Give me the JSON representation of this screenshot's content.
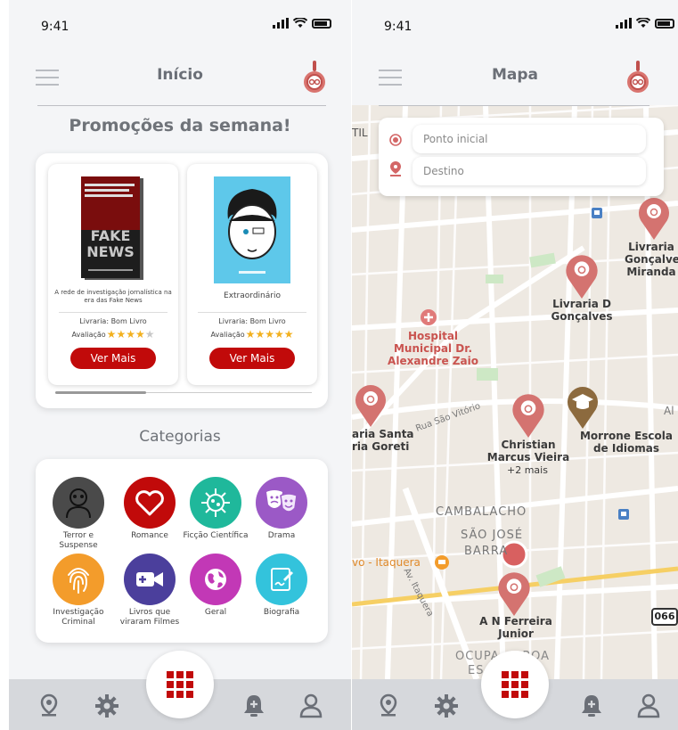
{
  "status": {
    "time": "9:41"
  },
  "home": {
    "title": "Início",
    "promo_title": "Promoções da semana!",
    "books": [
      {
        "title": "A rede de investigação jornalística na era das Fake News",
        "store_label": "Livraria:",
        "store": "Bom Livro",
        "rating_label": "Avaliação",
        "rating": 4,
        "button": "Ver Mais"
      },
      {
        "title": "Extraordinário",
        "store_label": "Livraria:",
        "store": "Bom Livro",
        "rating_label": "Avaliação",
        "rating": 5,
        "button": "Ver Mais"
      }
    ],
    "categories_title": "Categorias",
    "categories": [
      {
        "label": "Terror e Suspense",
        "color": "#4a4a4a",
        "icon": "zombie-icon"
      },
      {
        "label": "Romance",
        "color": "#c10a0a",
        "icon": "heart-icon"
      },
      {
        "label": "Ficção Científica",
        "color": "#1fb89b",
        "icon": "virus-icon"
      },
      {
        "label": "Drama",
        "color": "#9b59c6",
        "icon": "theater-masks-icon"
      },
      {
        "label": "Investigação Criminal",
        "color": "#f39c2b",
        "icon": "fingerprint-icon"
      },
      {
        "label": "Livros que viraram Filmes",
        "color": "#4b3f9c",
        "icon": "video-camera-icon"
      },
      {
        "label": "Geral",
        "color": "#c238b6",
        "icon": "globe-icon"
      },
      {
        "label": "Biografia",
        "color": "#33c3dc",
        "icon": "writing-icon"
      }
    ]
  },
  "map": {
    "title": "Mapa",
    "start_placeholder": "Ponto inicial",
    "dest_placeholder": "Destino",
    "labels": {
      "til": "TIL",
      "livraria_top": "Livraria Gonçalve Miranda",
      "livraria_d": "Livraria D Gonçalves",
      "hospital": "Hospital Municipal Dr. Alexandre Zaio",
      "santa": "aria Santa ria Goreti",
      "rua": "Rua São Vitório",
      "christian": "Christian Marcus Vieira",
      "christian_more": "+2 mais",
      "morrone": "Morrone Escola de Idiomas",
      "al": "Al",
      "cambalacho": "CAMBALACHO",
      "sao_jose": "SÃO JOSÉ",
      "barra": "BARRA",
      "itaquera": "vo - Itaquera",
      "av_itaquera": "Av. Itaquera",
      "ferreira": "A N Ferreira Junior",
      "ocupa": "OCUPA     BOA",
      "es": "ES",
      "route": "066"
    }
  },
  "colors": {
    "accent": "#c10a0a",
    "pin": "#d47370",
    "nav": "#d6d8dc"
  }
}
